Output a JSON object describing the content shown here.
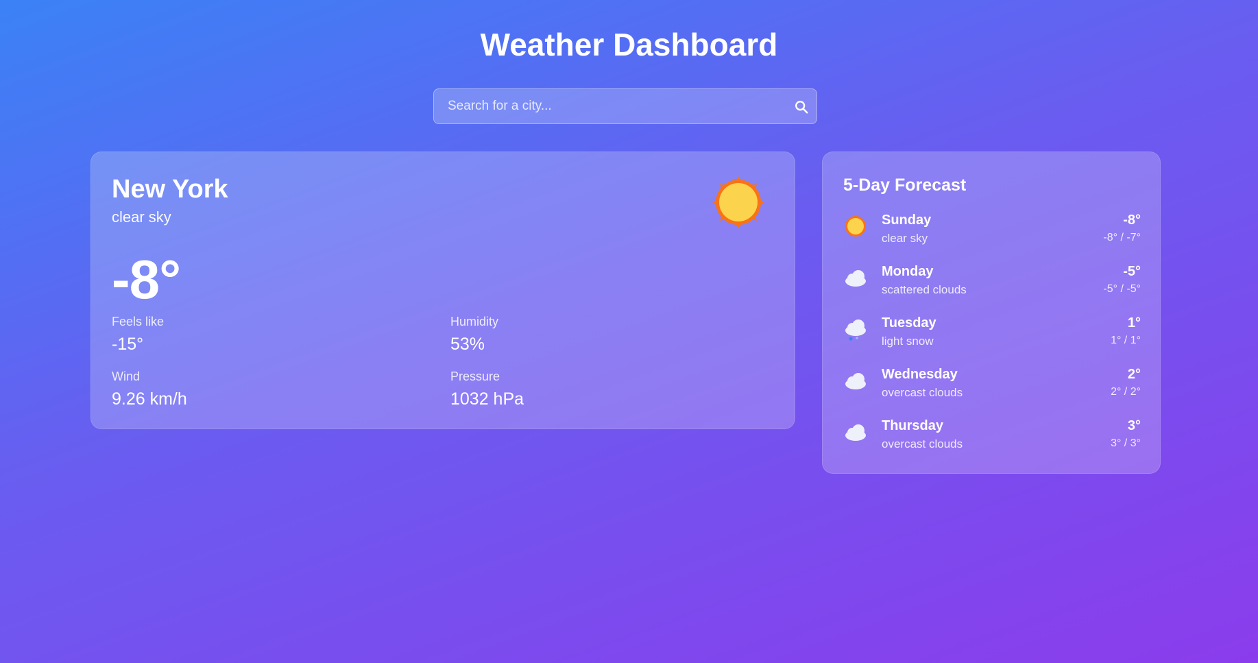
{
  "header": {
    "title": "Weather Dashboard"
  },
  "search": {
    "placeholder": "Search for a city...",
    "value": "",
    "icon": "search-icon"
  },
  "current": {
    "city": "New York",
    "condition": "clear sky",
    "icon": "sun-icon",
    "temperature": "-8°",
    "stats": {
      "feels_like": {
        "label": "Feels like",
        "value": "-15°"
      },
      "humidity": {
        "label": "Humidity",
        "value": "53%"
      },
      "wind": {
        "label": "Wind",
        "value": "9.26 km/h"
      },
      "pressure": {
        "label": "Pressure",
        "value": "1032 hPa"
      }
    }
  },
  "forecast": {
    "title": "5-Day Forecast",
    "days": [
      {
        "day": "Sunday",
        "desc": "clear sky",
        "temp": "-8°",
        "range": "-8° / -7°",
        "icon": "sun-icon"
      },
      {
        "day": "Monday",
        "desc": "scattered clouds",
        "temp": "-5°",
        "range": "-5° / -5°",
        "icon": "cloud-icon"
      },
      {
        "day": "Tuesday",
        "desc": "light snow",
        "temp": "1°",
        "range": "1° / 1°",
        "icon": "snow-cloud-icon"
      },
      {
        "day": "Wednesday",
        "desc": "overcast clouds",
        "temp": "2°",
        "range": "2° / 2°",
        "icon": "cloud-icon"
      },
      {
        "day": "Thursday",
        "desc": "overcast clouds",
        "temp": "3°",
        "range": "3° / 3°",
        "icon": "cloud-icon"
      }
    ]
  },
  "colors": {
    "sun_core": "#fcd34d",
    "sun_ray": "#f97316",
    "cloud": "#eef0fa",
    "snow": "#3b82f6"
  }
}
